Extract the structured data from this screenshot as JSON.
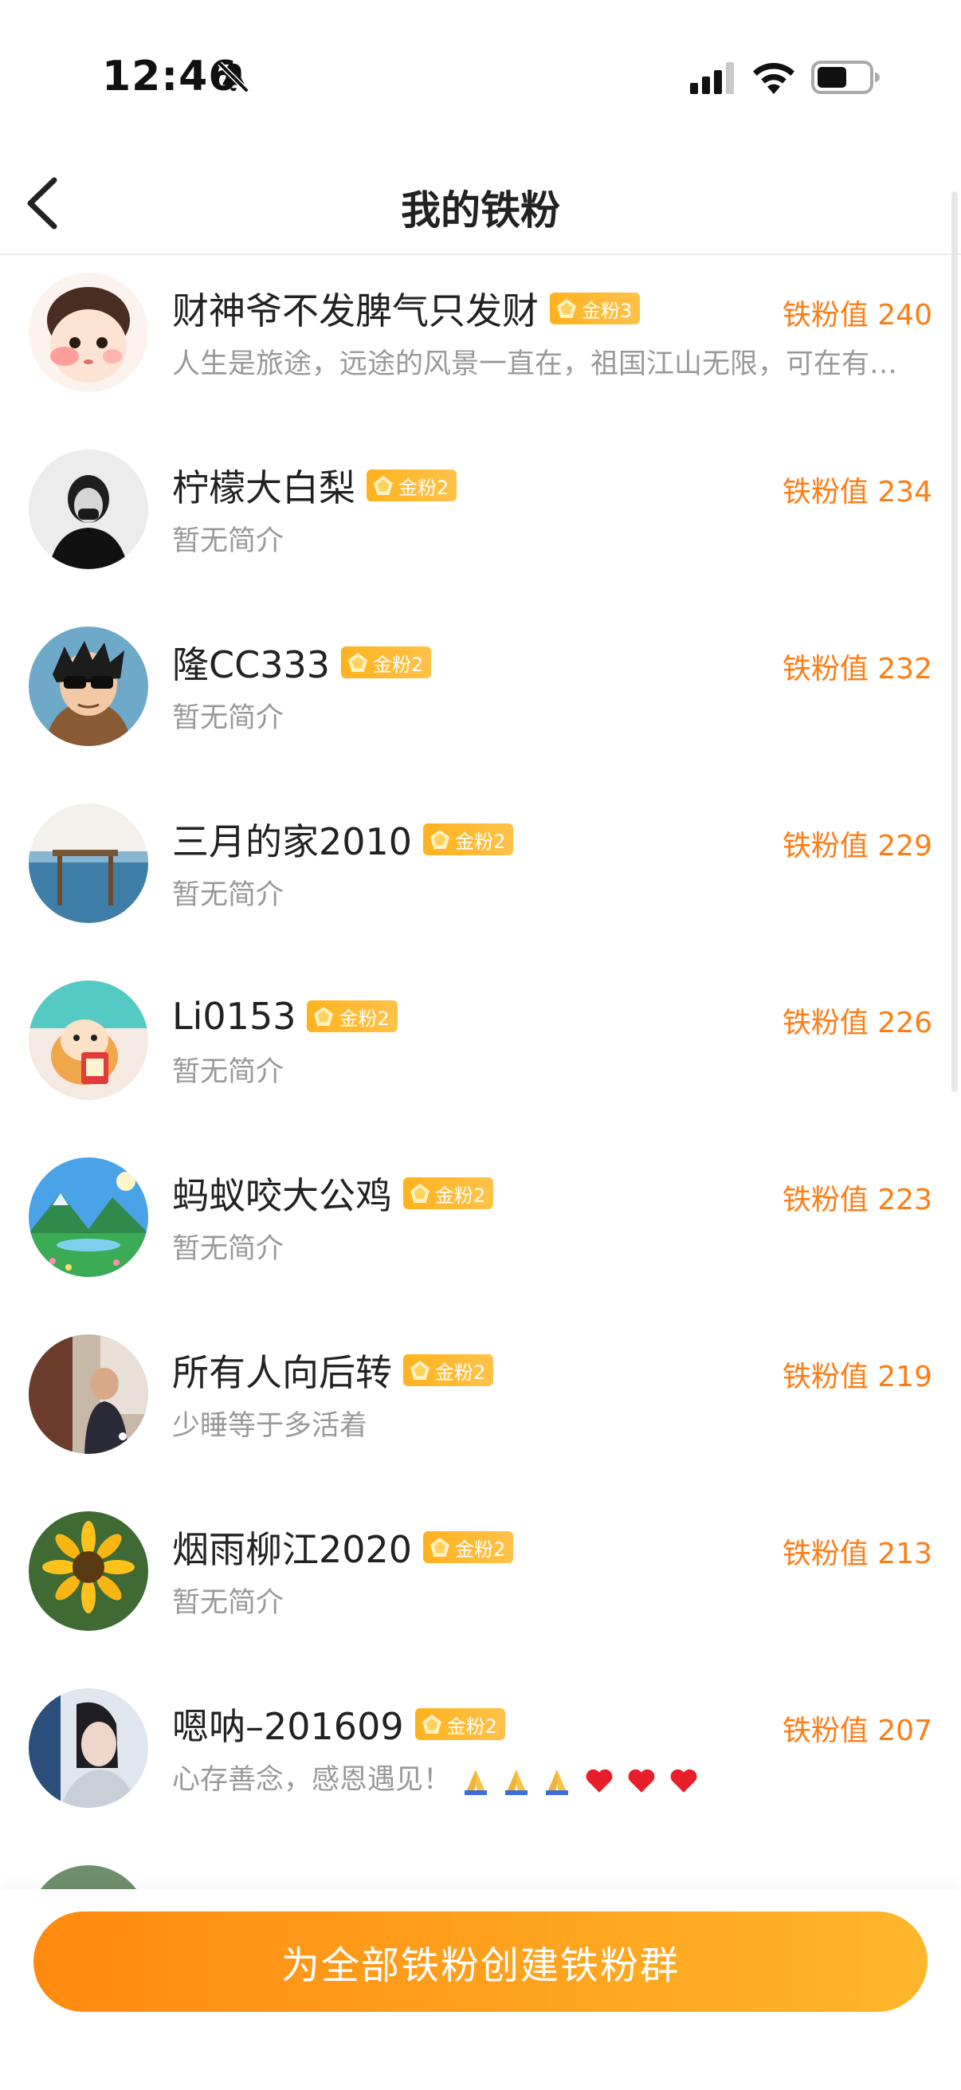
{
  "status_bar": {
    "time": "12:46"
  },
  "header": {
    "title": "我的铁粉"
  },
  "score_prefix": "铁粉值",
  "fans": [
    {
      "name": "财神爷不发脾气只发财",
      "badge": "金粉3",
      "score": "240",
      "bio": "人生是旅途，远途的风景一直在，祖国江山无限，可在有…",
      "avatar": "cartoon-girl-avatar"
    },
    {
      "name": "柠檬大白梨",
      "badge": "金粉2",
      "score": "234",
      "bio": "暂无简介",
      "avatar": "bw-portrait-avatar"
    },
    {
      "name": "隆CC333",
      "badge": "金粉2",
      "score": "232",
      "bio": "暂无简介",
      "avatar": "cartoon-sunglasses-avatar"
    },
    {
      "name": "三月的家2010",
      "badge": "金粉2",
      "score": "229",
      "bio": "暂无简介",
      "avatar": "seaside-sign-avatar"
    },
    {
      "name": "Li0153",
      "badge": "金粉2",
      "score": "226",
      "bio": "暂无简介",
      "avatar": "fortune-cat-avatar"
    },
    {
      "name": "蚂蚁咬大公鸡",
      "badge": "金粉2",
      "score": "223",
      "bio": "暂无简介",
      "avatar": "landscape-avatar"
    },
    {
      "name": "所有人向后转",
      "badge": "金粉2",
      "score": "219",
      "bio": "少睡等于多活着",
      "avatar": "street-photo-avatar"
    },
    {
      "name": "烟雨柳江2020",
      "badge": "金粉2",
      "score": "213",
      "bio": "暂无简介",
      "avatar": "sunflower-avatar"
    },
    {
      "name": "嗯呐–201609",
      "badge": "金粉2",
      "score": "207",
      "bio": "心存善念，感恩遇见！",
      "avatar": "girl-portrait-avatar"
    }
  ],
  "bottom_button": {
    "label": "为全部铁粉创建铁粉群"
  },
  "colors": {
    "accent": "#ff7d14",
    "badge": "#ffb21e",
    "button_start": "#ff8a10",
    "button_end": "#ffb62a"
  }
}
